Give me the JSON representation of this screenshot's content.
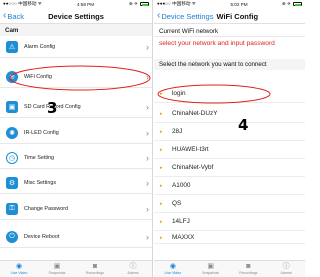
{
  "left": {
    "status": {
      "carrier": "●●○○○ 中国移动 ᯤ",
      "time": "4:58 PM",
      "right": "⊕ ✈"
    },
    "back_label": "Back",
    "title": "Device Settings",
    "section": "Cam",
    "items": [
      {
        "label": "Alarm Config",
        "icon": "⚠"
      },
      {
        "label": "WiFi Config",
        "icon": "≋"
      },
      {
        "label": "SD Card Record Config",
        "icon": "▣"
      },
      {
        "label": "IR-LED Config",
        "icon": "✺"
      },
      {
        "label": "Time Setting",
        "icon": "◷"
      },
      {
        "label": "Misc Settings",
        "icon": "⚙"
      },
      {
        "label": "Change Password",
        "icon": "⚿"
      },
      {
        "label": "Device Reboot",
        "icon": "⏻"
      }
    ],
    "chevron": "›",
    "annotation_number": "3",
    "tabs": [
      {
        "label": "Live Video",
        "icon": "◉"
      },
      {
        "label": "Snapshots",
        "icon": "▣"
      },
      {
        "label": "Recordings",
        "icon": "◙"
      },
      {
        "label": "Alarms",
        "icon": "ⓘ"
      }
    ]
  },
  "right": {
    "status": {
      "carrier": "●●●○○ 中国移动 ᯤ",
      "time": "5:02 PM",
      "right": "⊕ ✈"
    },
    "back_label": "Device Settings",
    "title": "WiFi Config",
    "current_network_label": "Current WiFi network",
    "instruction": "select your network and input password",
    "select_header": "Select the network you want to connect",
    "networks": [
      "login",
      "ChinaNet-DUzY",
      "28J",
      "HUAWEI-t3rt",
      "ChinaNet-Vybf",
      "A1000",
      "QS",
      "14LFJ",
      "MAXXX"
    ],
    "network_icon": "▸",
    "annotation_number": "4",
    "tabs": [
      {
        "label": "Live Video",
        "icon": "◉"
      },
      {
        "label": "Snapshots",
        "icon": "▣"
      },
      {
        "label": "Recordings",
        "icon": "◙"
      },
      {
        "label": "Alarms",
        "icon": "ⓘ"
      }
    ]
  },
  "colors": {
    "accent": "#1a7fd6",
    "icon_bg": "#1f8fd4",
    "annotation": "#e02020",
    "network_icon": "#e8a400"
  }
}
